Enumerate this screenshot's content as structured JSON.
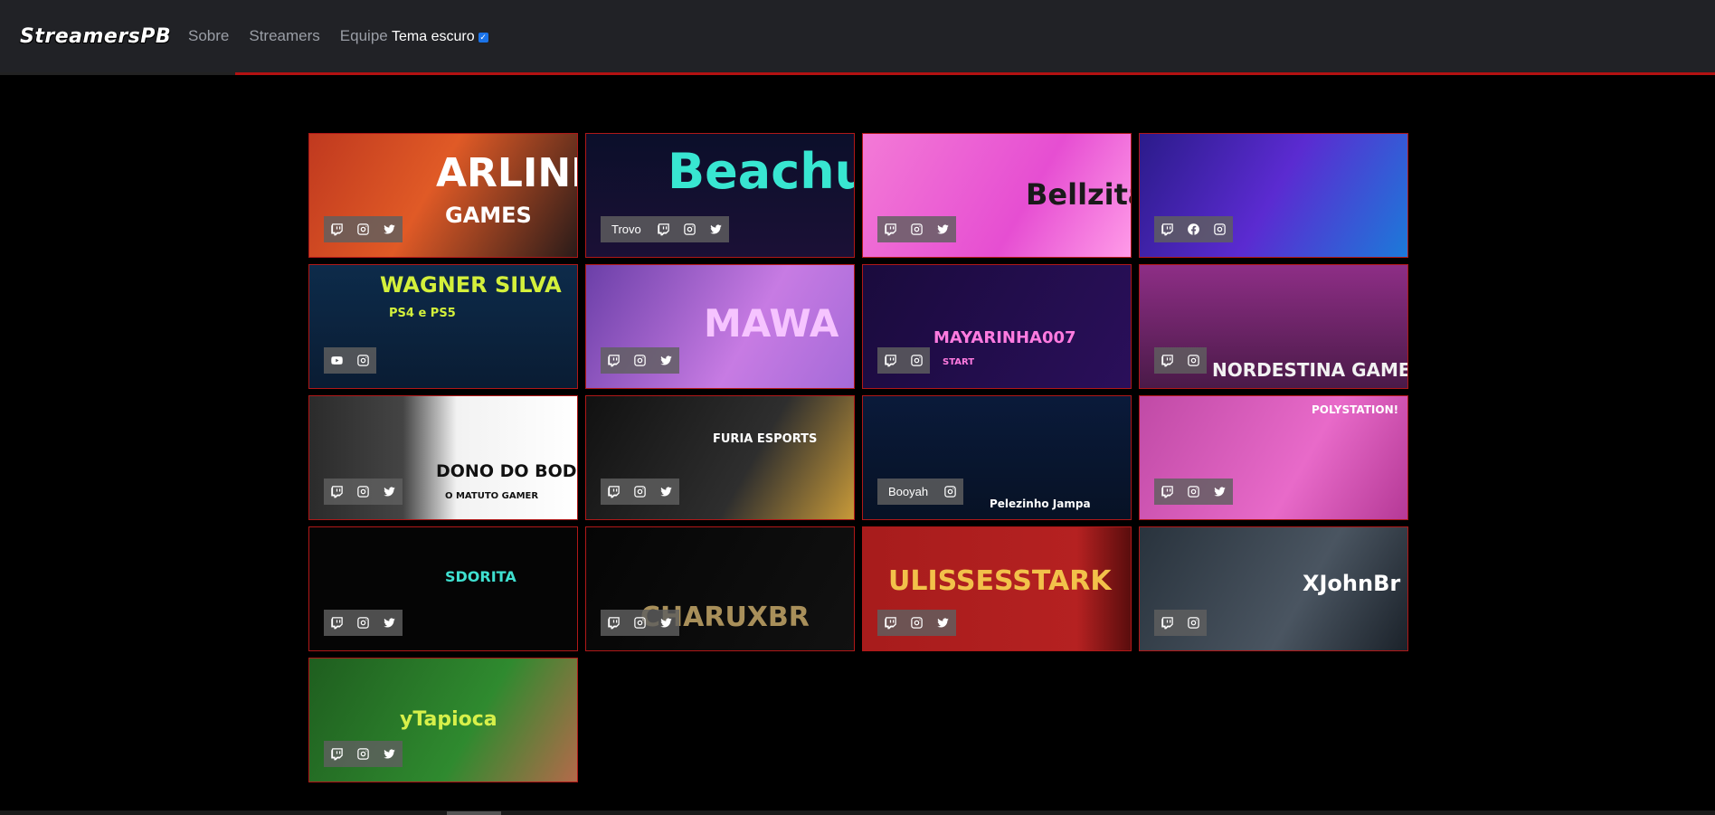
{
  "nav": {
    "logo": "StreamersPB",
    "links": [
      "Sobre",
      "Streamers",
      "Equipe"
    ],
    "theme_label": "Tema escuro",
    "theme_checked": true
  },
  "streamers": [
    {
      "title": "ARLINDO",
      "subtitle": "GAMES",
      "platform": "",
      "icons": [
        "twitch-icon",
        "instagram-icon",
        "twitter-icon"
      ],
      "bg": "linear-gradient(120deg,#c0391f 0%,#e05a26 45%,#2a1b19 100%)",
      "tcolor": "#ffffff"
    },
    {
      "title": "Beachu",
      "subtitle": "",
      "platform": "Trovo",
      "icons": [
        "twitch-icon",
        "instagram-icon",
        "twitter-icon"
      ],
      "bg": "linear-gradient(180deg,#0b0f2a 0%,#1b1036 100%)",
      "tcolor": "#38e6d1"
    },
    {
      "title": "Bellzita",
      "subtitle": "",
      "platform": "",
      "icons": [
        "twitch-icon",
        "instagram-icon",
        "twitter-icon"
      ],
      "bg": "linear-gradient(120deg,#f37ad6 0%,#e64ed2 60%,#ff9be8 100%)",
      "tcolor": "#1a1a1a"
    },
    {
      "title": "",
      "subtitle": "",
      "platform": "",
      "icons": [
        "twitch-icon",
        "facebook-icon",
        "instagram-icon"
      ],
      "bg": "linear-gradient(120deg,#2b1b8a 0%,#5b2bd1 50%,#1c7ad9 100%)",
      "tcolor": "#ffffff"
    },
    {
      "title": "WAGNER SILVA",
      "subtitle": "PS4 e PS5",
      "platform": "",
      "icons": [
        "youtube-icon",
        "instagram-icon"
      ],
      "bg": "linear-gradient(180deg,#0d2b4a 0%,#0a1c33 100%)",
      "tcolor": "#d4f03b"
    },
    {
      "title": "MAWA",
      "subtitle": "",
      "platform": "",
      "icons": [
        "twitch-icon",
        "instagram-icon",
        "twitter-icon"
      ],
      "bg": "linear-gradient(120deg,#6b3fa8 0%,#c77be3 60%,#a56ad8 100%)",
      "tcolor": "#f6c4ff"
    },
    {
      "title": "MAYARINHA007",
      "subtitle": "START",
      "platform": "",
      "icons": [
        "twitch-icon",
        "instagram-icon"
      ],
      "bg": "linear-gradient(120deg,#1a0b3d 0%,#2a0f5a 100%)",
      "tcolor": "#ff7be0"
    },
    {
      "title": "NORDESTINA GAMER",
      "subtitle": "",
      "platform": "",
      "icons": [
        "twitch-icon",
        "instagram-icon"
      ],
      "bg": "linear-gradient(180deg,#8e2e86 0%,#4a1a48 100%)",
      "tcolor": "#f2f2f2"
    },
    {
      "title": "DONO DO BODE",
      "subtitle": "O MATUTO GAMER",
      "platform": "",
      "icons": [
        "twitch-icon",
        "instagram-icon",
        "twitter-icon"
      ],
      "bg": "linear-gradient(90deg,#2b2b2b 0%,#444 35%,#f2f2f2 55%,#ffffff 100%)",
      "tcolor": "#111111"
    },
    {
      "title": "FURIA ESPORTS",
      "subtitle": "",
      "platform": "",
      "icons": [
        "twitch-icon",
        "instagram-icon",
        "twitter-icon"
      ],
      "bg": "linear-gradient(120deg,#111 0%,#2e2e2e 60%,#c89a39 100%)",
      "tcolor": "#ffffff"
    },
    {
      "title": "Pelezinho Jampa",
      "subtitle": "",
      "platform": "Booyah",
      "icons": [
        "instagram-icon"
      ],
      "bg": "linear-gradient(180deg,#0a1a3a 0%,#071225 100%)",
      "tcolor": "#ffffff"
    },
    {
      "title": "POLYSTATION!",
      "subtitle": "",
      "platform": "",
      "icons": [
        "twitch-icon",
        "instagram-icon",
        "twitter-icon"
      ],
      "bg": "linear-gradient(120deg,#c04aa6 0%,#e86ac9 60%,#b53996 100%)",
      "tcolor": "#ffffff"
    },
    {
      "title": "SDORITA",
      "subtitle": "",
      "platform": "",
      "icons": [
        "twitch-icon",
        "instagram-icon",
        "twitter-icon"
      ],
      "bg": "#050505",
      "tcolor": "#3fe0d0"
    },
    {
      "title": "CHARUXBR",
      "subtitle": "",
      "platform": "",
      "icons": [
        "twitch-icon",
        "instagram-icon",
        "twitter-icon"
      ],
      "bg": "linear-gradient(120deg,#050505 0%,#111 100%)",
      "tcolor": "#a88f5a"
    },
    {
      "title": "ULISSESSTARK",
      "subtitle": "",
      "platform": "",
      "icons": [
        "twitch-icon",
        "instagram-icon",
        "twitter-icon"
      ],
      "bg": "linear-gradient(90deg,#a71c1c 0%,#b52121 80%,#5a0d0d 100%)",
      "tcolor": "#f2c14a"
    },
    {
      "title": "XJohnBr",
      "subtitle": "",
      "platform": "",
      "icons": [
        "twitch-icon",
        "instagram-icon"
      ],
      "bg": "linear-gradient(120deg,#29333d 0%,#4a5561 60%,#1b222a 100%)",
      "tcolor": "#ffffff"
    },
    {
      "title": "yTapioca",
      "subtitle": "",
      "platform": "",
      "icons": [
        "twitch-icon",
        "instagram-icon",
        "twitter-icon"
      ],
      "bg": "linear-gradient(120deg,#1f5e1f 0%,#2f8a2f 60%,#b36a4a 100%)",
      "tcolor": "#d7f04a"
    }
  ]
}
